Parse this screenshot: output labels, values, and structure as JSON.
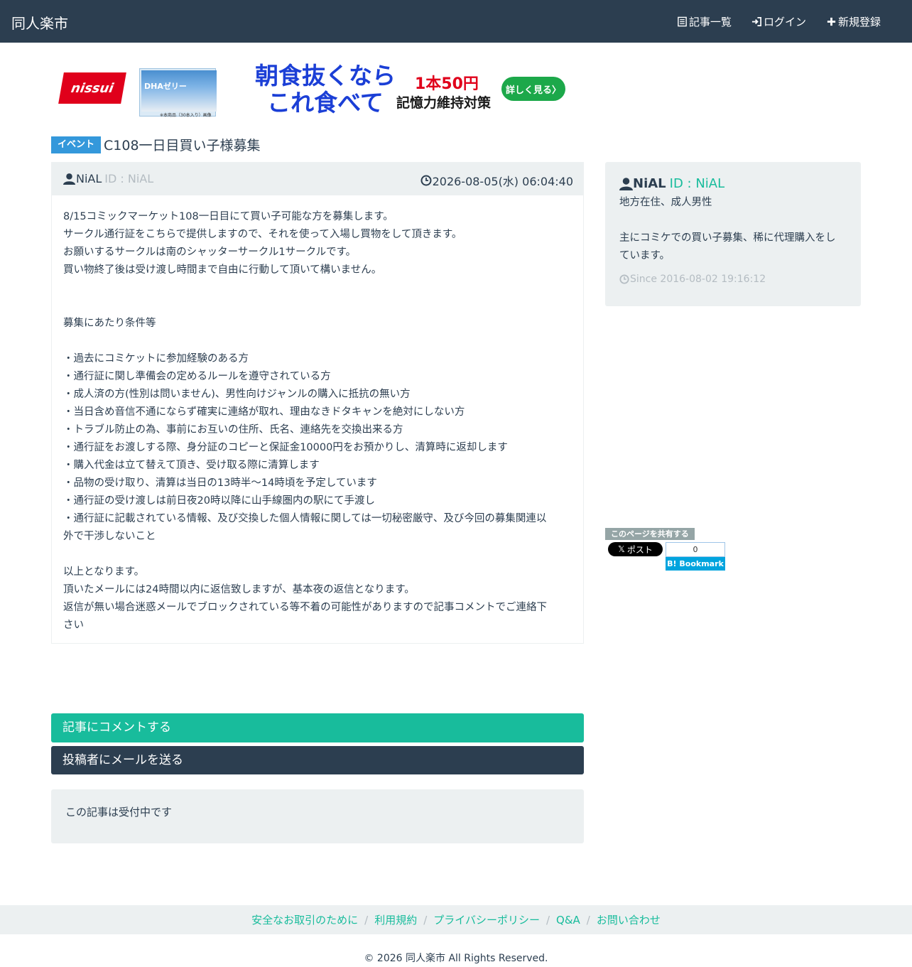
{
  "navbar": {
    "brand": "同人楽市",
    "links": [
      {
        "label": "記事一覧",
        "icon": "list-icon"
      },
      {
        "label": "ログイン",
        "icon": "login-icon"
      },
      {
        "label": "新規登録",
        "icon": "plus-icon"
      }
    ]
  },
  "ad": {
    "logo": "nissui",
    "product_text": "DHAゼリー",
    "product_caption": "※本商品（30本入り）画像",
    "headline_1": "朝食抜くなら",
    "headline_2": "これ食べて",
    "price": "1本50円",
    "subline": "記憶力維持対策",
    "cta": "詳しく見る〉"
  },
  "article": {
    "category_badge": "イベント",
    "title": "C108一日目買い子様募集",
    "author_name": "NiAL",
    "author_id": "ID : NiAL",
    "posted_at": "2026-08-05(水) 06:04:40",
    "body_lines": [
      "8/15コミックマーケット108一日目にて買い子可能な方を募集します。",
      "サークル通行証をこちらで提供しますので、それを使って入場し買物をして頂きます。",
      "お願いするサークルは南のシャッターサークル1サークルです。",
      "買い物終了後は受け渡し時間まで自由に行動して頂いて構いません。",
      "",
      "",
      "募集にあたり条件等",
      "",
      "・過去にコミケットに参加経験のある方",
      "・通行証に関し準備会の定めるルールを遵守されている方",
      "・成人済の方(性別は問いません)、男性向けジャンルの購入に抵抗の無い方",
      "・当日含め音信不通にならず確実に連絡が取れ、理由なきドタキャンを絶対にしない方",
      "・トラブル防止の為、事前にお互いの住所、氏名、連絡先を交換出来る方",
      "・通行証をお渡しする際、身分証のコピーと保証金10000円をお預かりし、清算時に返却します",
      "・購入代金は立て替えて頂き、受け取る際に清算します",
      "・品物の受け取り、清算は当日の13時半〜14時頃を予定しています",
      "・通行証の受け渡しは前日夜20時以降に山手線圏内の駅にて手渡し",
      "・通行証に記載されている情報、及び交換した個人情報に関しては一切秘密厳守、及び今回の募集関連以",
      "外で干渉しないこと",
      "",
      "以上となります。",
      "頂いたメールには24時間以内に返信致しますが、基本夜の返信となります。",
      "返信が無い場合迷惑メールでブロックされている等不着の可能性がありますので記事コメントでご連絡下",
      "さい"
    ],
    "comment_button": "記事にコメントする",
    "mail_button": "投稿者にメールを送る",
    "status_text": "この記事は受付中です"
  },
  "profile": {
    "name": "NiAL",
    "id": "ID : NiAL",
    "bio_lines": [
      "地方在住、成人男性",
      "",
      "主にコミケでの買い子募集、稀に代理購入をし",
      "ています。"
    ],
    "since": "Since 2016-08-02 19:16:12"
  },
  "share": {
    "label": "このページを共有する",
    "x_label": "ポスト",
    "hatena_count": "0",
    "hatena_label": "B! Bookmark"
  },
  "footer": {
    "links": [
      "安全なお取引のために",
      "利用規約",
      "プライバシーポリシー",
      "Q&A",
      "お問い合わせ"
    ],
    "copyright": "© 2026 同人楽市 All Rights Reserved."
  },
  "colors": {
    "navbar": "#2c3e50",
    "accent": "#18bc9c",
    "badge": "#3498db",
    "panel_bg": "#ecf0f1"
  }
}
